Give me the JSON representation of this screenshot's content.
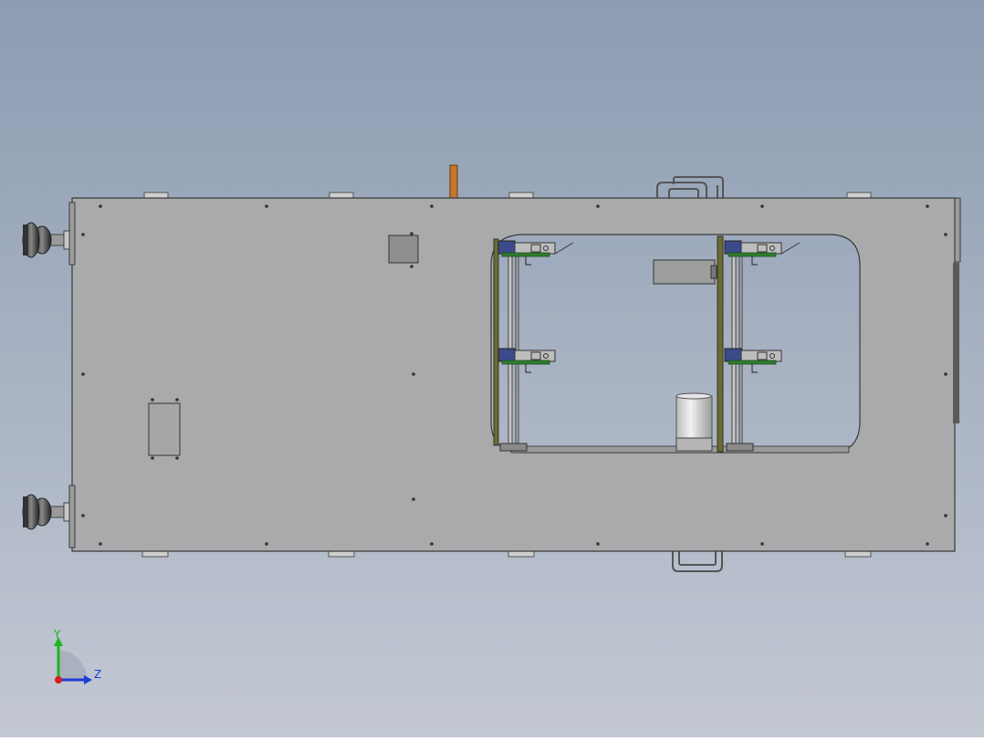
{
  "viewport": {
    "background_top": "#8c9cb2",
    "background_bottom": "#c3c8d3"
  },
  "model": {
    "panel_fill": "#a9aaac",
    "panel_edge": "#3a3a3a",
    "window_fill": "#a3afc2",
    "rail_color": "#6b6b2e",
    "clamp_block_color": "#3b4a8a",
    "clamp_accent_color": "#2f7d2f",
    "handle_color": "#cfcfcf",
    "handle_edge": "#555555",
    "orange_tab_color": "#c4782e",
    "foot_color": "#3a3a3a"
  },
  "triad": {
    "y_label": "Y",
    "z_label": "Z",
    "y_color": "#1cb51c",
    "z_color": "#1e3cd6",
    "x_color": "#d61e1e"
  }
}
